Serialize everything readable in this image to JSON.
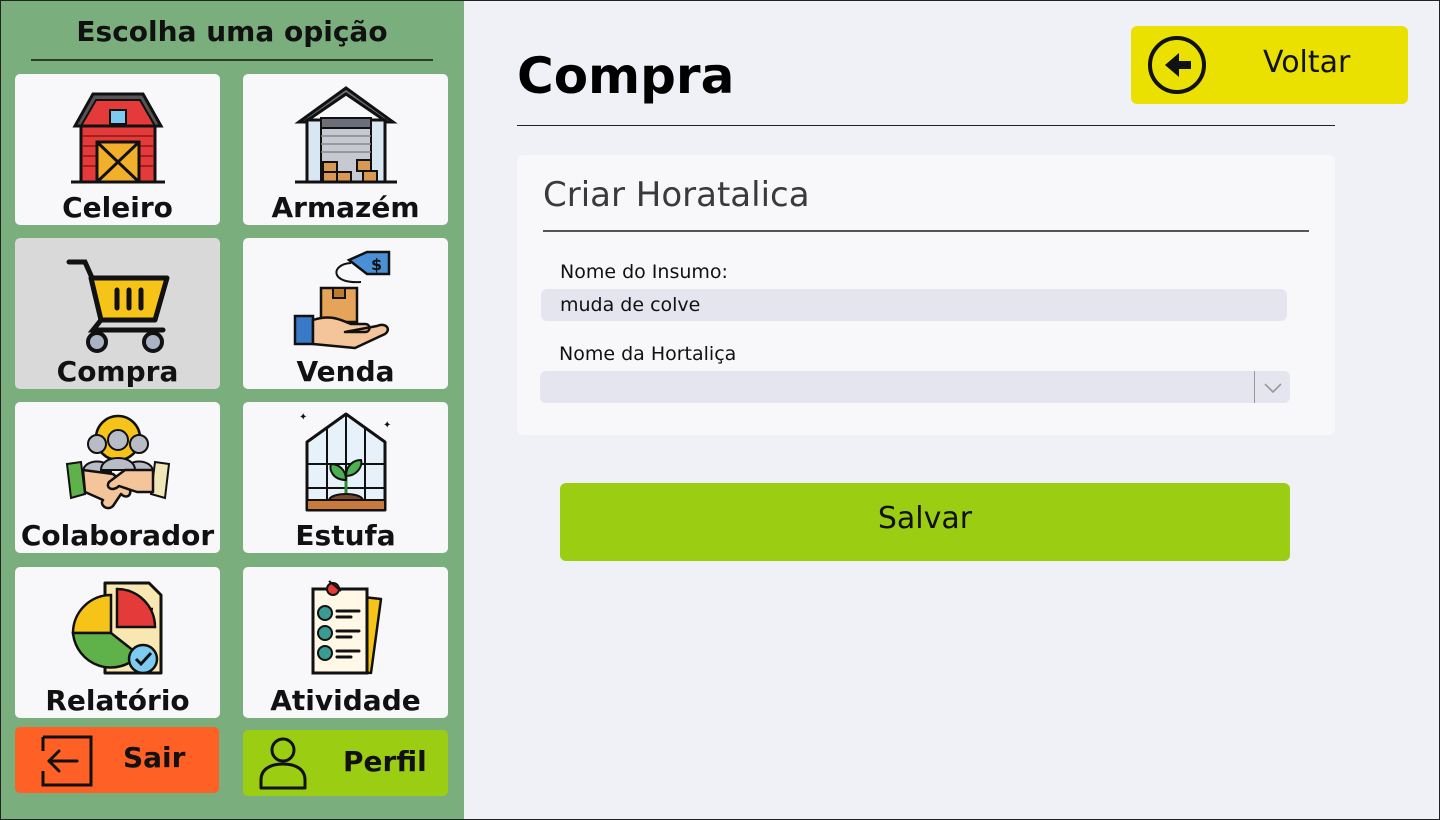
{
  "sidebar": {
    "title": "Escolha uma opição",
    "tiles": [
      {
        "label": "Celeiro",
        "icon": "barn-icon"
      },
      {
        "label": "Armazém",
        "icon": "warehouse-icon"
      },
      {
        "label": "Compra",
        "icon": "shopping-cart-icon",
        "active": true
      },
      {
        "label": "Venda",
        "icon": "sell-hand-icon"
      },
      {
        "label": "Colaborador",
        "icon": "handshake-team-icon"
      },
      {
        "label": "Estufa",
        "icon": "greenhouse-icon"
      },
      {
        "label": "Relatório",
        "icon": "report-chart-icon"
      },
      {
        "label": "Atividade",
        "icon": "checklist-icon"
      }
    ],
    "sair_label": "Sair",
    "perfil_label": "Perfil"
  },
  "header": {
    "title": "Compra",
    "back_label": "Voltar"
  },
  "form": {
    "card_title": "Criar Horatalica",
    "insumo_label": "Nome do Insumo:",
    "insumo_value": "muda de colve",
    "hortalica_label": "Nome da Hortaliça",
    "hortalica_value": "",
    "save_label": "Salvar"
  },
  "colors": {
    "sidebar_bg": "#7aae7c",
    "main_bg": "#f0f1f6",
    "back_button": "#ebe100",
    "save_button": "#9bcd12",
    "exit_button": "#fe6026"
  }
}
